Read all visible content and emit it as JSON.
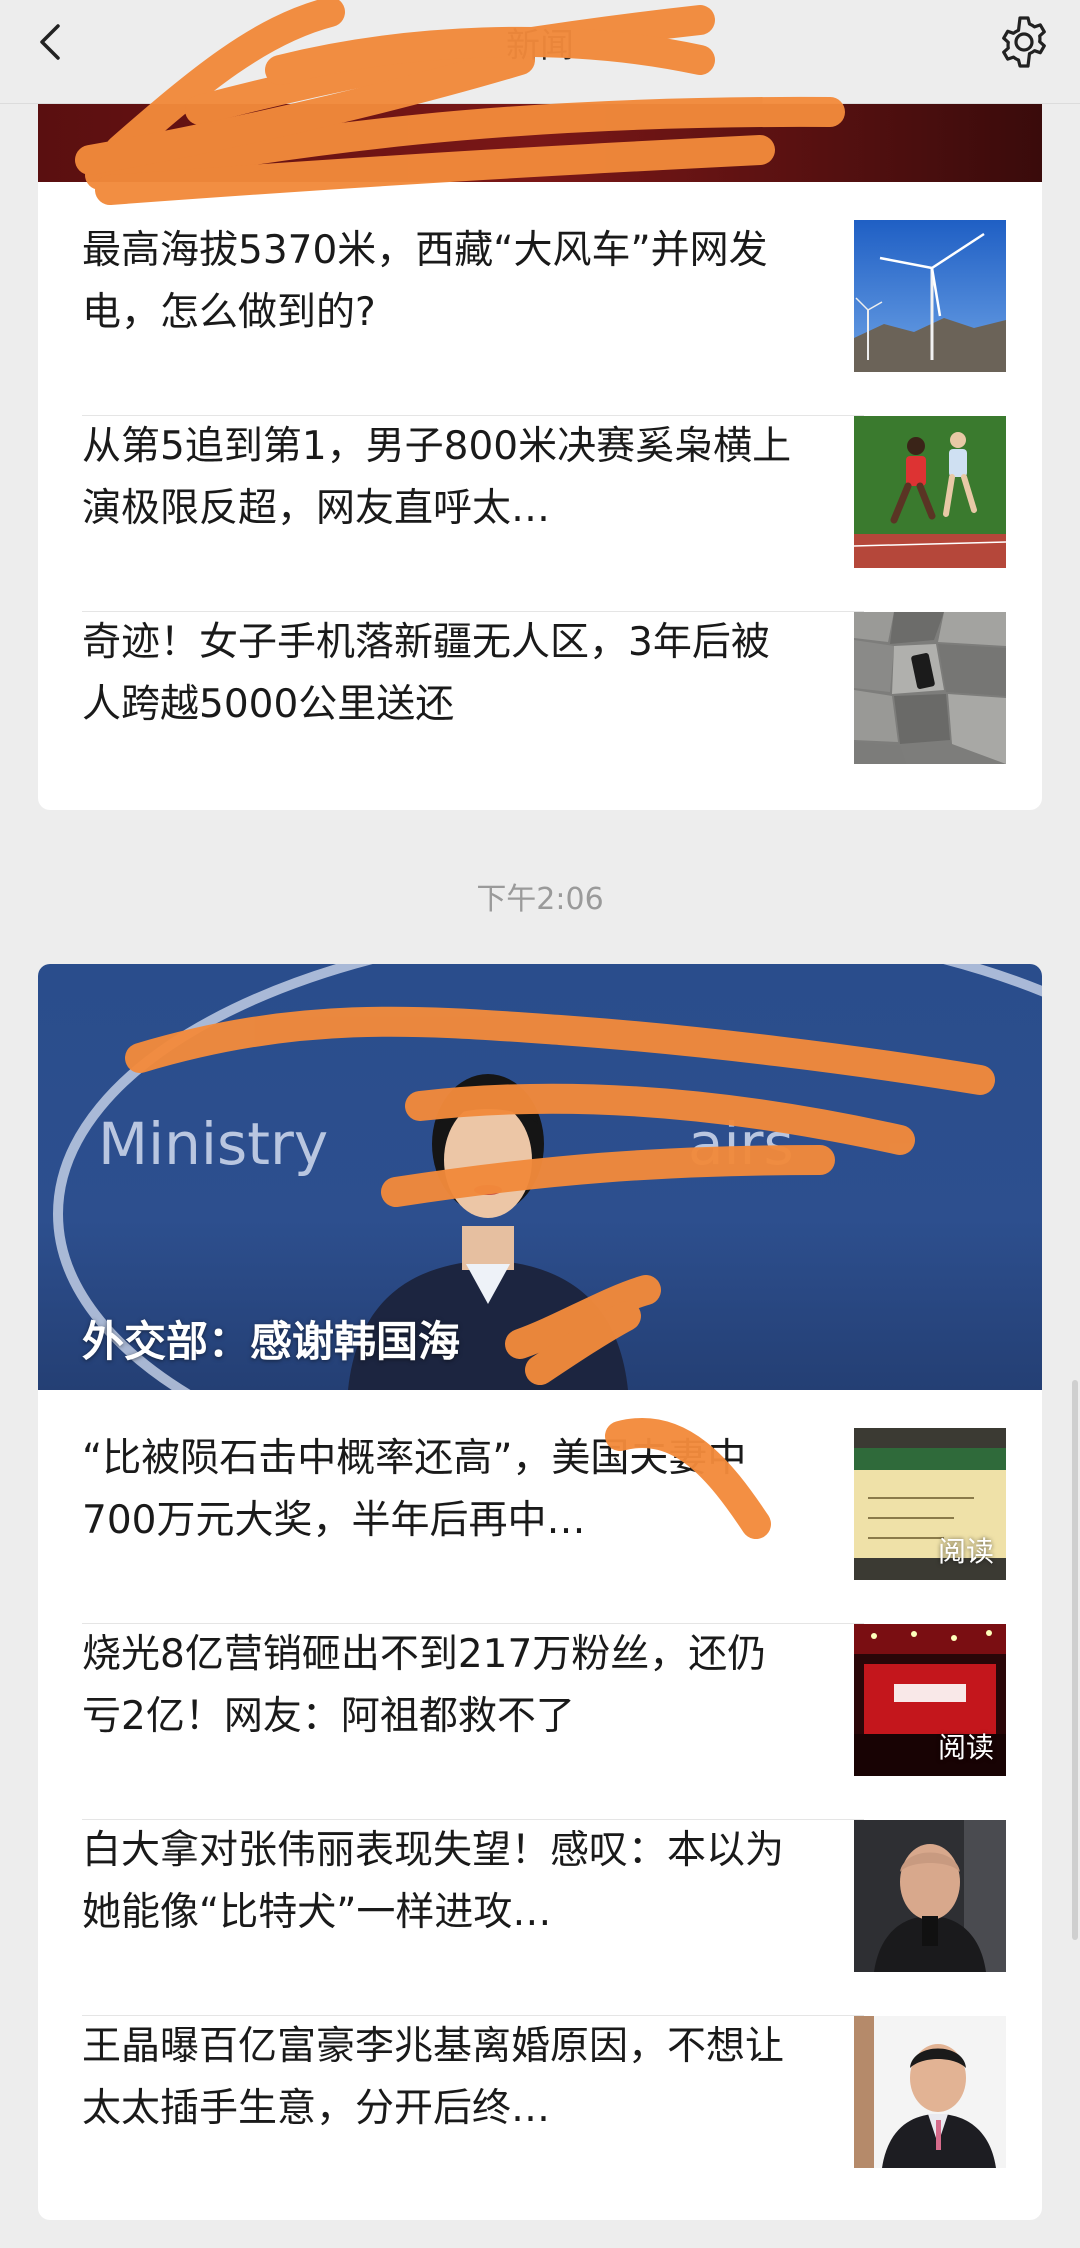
{
  "topbar": {
    "title": "新闻",
    "back_icon": "chevron-left-icon",
    "settings_icon": "gear-icon"
  },
  "group1": {
    "banner_title": "",
    "items": [
      {
        "title": "最高海拔5370米，西藏“大风车”并网发电，怎么做到的?",
        "thumb_icon": "wind-turbine-image",
        "badge": ""
      },
      {
        "title": "从第5追到第1，男子800米决赛奚枭横上演极限反超，网友直呼太…",
        "thumb_icon": "runners-image",
        "badge": ""
      },
      {
        "title": "奇迹！女子手机落新疆无人区，3年后被人跨越5000公里送还",
        "thumb_icon": "rocks-phone-image",
        "badge": ""
      }
    ]
  },
  "timestamp": "下午2:06",
  "group2": {
    "banner_title": "外交部：感谢韩国海",
    "banner_bg_text": "Ministry",
    "items": [
      {
        "title": "“比被陨石击中概率还高”，美国夫妻中700万元大奖，半年后再中…",
        "thumb_icon": "lottery-check-image",
        "badge": "阅读"
      },
      {
        "title": "烧光8亿营销砸出不到217万粉丝，还仍亏2亿！网友：阿祖都救不了",
        "thumb_icon": "stage-event-image",
        "badge": "阅读"
      },
      {
        "title": "白大拿对张伟丽表现失望！感叹：本以为她能像“比特犬”一样进攻…",
        "thumb_icon": "press-conference-image",
        "badge": ""
      },
      {
        "title": "王晶曝百亿富豪李兆基离婚原因，不想让太太插手生意，分开后终…",
        "thumb_icon": "businessman-image",
        "badge": ""
      }
    ]
  },
  "colors": {
    "background": "#ededed",
    "card": "#ffffff",
    "title_text": "#1a1a1a",
    "timestamp": "#9a9a9a",
    "scribble": "#f28a3b"
  }
}
